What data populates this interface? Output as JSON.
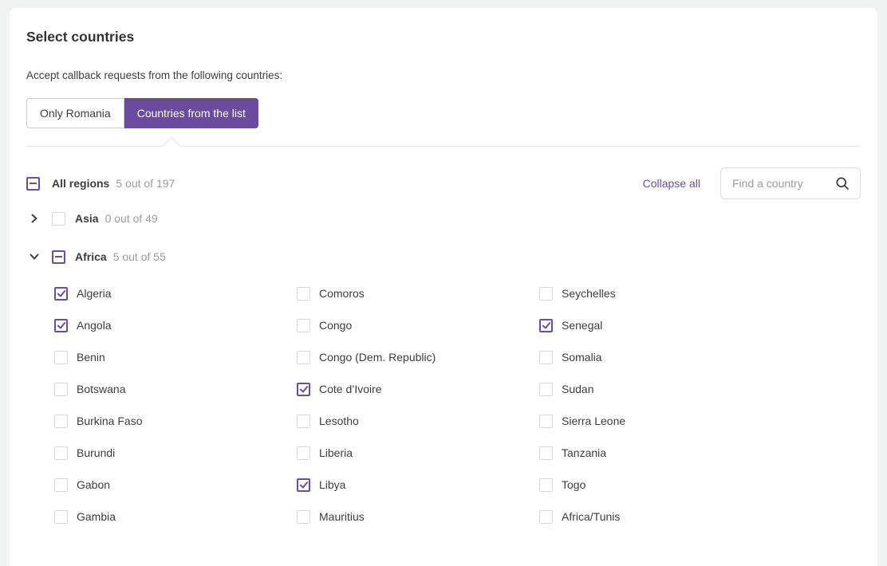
{
  "colors": {
    "page_background": "#f1f2f2",
    "card_background": "#ffffff",
    "accent_purple": "#6a4b9d",
    "checkbox_purple": "#67509b",
    "link_purple": "#6950a1",
    "text_dark": "#3d3d3d",
    "text_gray": "#9c9c9c"
  },
  "header": {
    "title": "Select countries",
    "description": "Accept callback requests from the following countries:",
    "toggle": [
      {
        "label": "Only Romania",
        "selected": false
      },
      {
        "label": "Countries from the list",
        "selected": true
      }
    ]
  },
  "controls": {
    "all_regions": {
      "label": "All regions",
      "count": "5 out of 197",
      "checkbox_state": "indeterminate"
    },
    "collapse_all_label": "Collapse all",
    "search": {
      "placeholder": "Find a country",
      "icon": "magnifier"
    }
  },
  "regions": [
    {
      "name": "Asia",
      "count": "0 out of 49",
      "expanded": false,
      "checkbox_state": "unchecked",
      "chevron": "right"
    },
    {
      "name": "Africa",
      "count": "5 out of 55",
      "expanded": true,
      "checkbox_state": "indeterminate",
      "chevron": "down"
    }
  ],
  "africa": {
    "columns": [
      [
        {
          "name": "Algeria",
          "checked": true
        },
        {
          "name": "Angola",
          "checked": true
        },
        {
          "name": "Benin",
          "checked": false
        },
        {
          "name": "Botswana",
          "checked": false
        },
        {
          "name": "Burkina Faso",
          "checked": false
        },
        {
          "name": "Burundi",
          "checked": false
        },
        {
          "name": "Gabon",
          "checked": false
        },
        {
          "name": "Gambia",
          "checked": false
        }
      ],
      [
        {
          "name": "Comoros",
          "checked": false
        },
        {
          "name": "Congo",
          "checked": false
        },
        {
          "name": "Congo (Dem. Republic)",
          "checked": false
        },
        {
          "name": "Cote d’Ivoire",
          "checked": true
        },
        {
          "name": "Lesotho",
          "checked": false
        },
        {
          "name": "Liberia",
          "checked": false
        },
        {
          "name": "Libya",
          "checked": true
        },
        {
          "name": "Mauritius",
          "checked": false
        }
      ],
      [
        {
          "name": "Seychelles",
          "checked": false
        },
        {
          "name": "Senegal",
          "checked": true
        },
        {
          "name": "Somalia",
          "checked": false
        },
        {
          "name": "Sudan",
          "checked": false
        },
        {
          "name": "Sierra Leone",
          "checked": false
        },
        {
          "name": "Tanzania",
          "checked": false
        },
        {
          "name": "Togo",
          "checked": false
        },
        {
          "name": "Africa/Tunis",
          "checked": false
        }
      ]
    ]
  }
}
